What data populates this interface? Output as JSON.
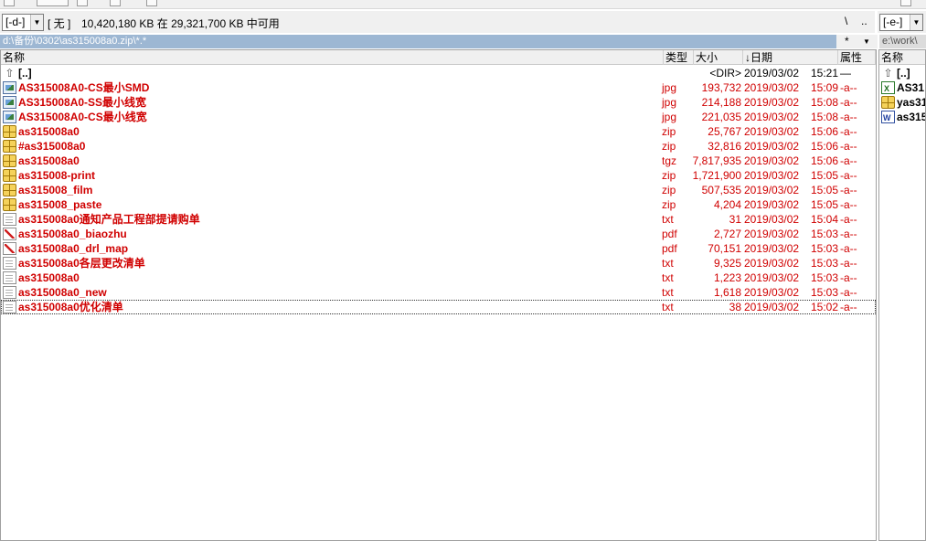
{
  "left_panel": {
    "drive": "[-d-]",
    "volume_label": "[ 无 ]",
    "free_space": "10,420,180 KB 在 29,321,700 KB 中可用",
    "nav_root": "\\",
    "nav_up": "..",
    "path": "d:\\备份\\0302\\as315008a0.zip\\*.*",
    "filter": "*",
    "filter_arrow": "▼",
    "columns": {
      "name": "名称",
      "ext": "类型",
      "size": "大小",
      "date": "↓日期",
      "attr": "属性"
    },
    "rows": [
      {
        "icon": "up-dir-icon",
        "name": "[..]",
        "ext": "",
        "size": "<DIR>",
        "date": "2019/03/02",
        "time": "15:21",
        "attr": "—",
        "red": false
      },
      {
        "icon": "image-icon",
        "name": "AS315008A0-CS最小SMD",
        "ext": "jpg",
        "size": "193,732",
        "date": "2019/03/02",
        "time": "15:09",
        "attr": "-a--",
        "red": true
      },
      {
        "icon": "image-icon",
        "name": "AS315008A0-SS最小线宽",
        "ext": "jpg",
        "size": "214,188",
        "date": "2019/03/02",
        "time": "15:08",
        "attr": "-a--",
        "red": true
      },
      {
        "icon": "image-icon",
        "name": "AS315008A0-CS最小线宽",
        "ext": "jpg",
        "size": "221,035",
        "date": "2019/03/02",
        "time": "15:08",
        "attr": "-a--",
        "red": true
      },
      {
        "icon": "archive-icon",
        "name": "as315008a0",
        "ext": "zip",
        "size": "25,767",
        "date": "2019/03/02",
        "time": "15:06",
        "attr": "-a--",
        "red": true
      },
      {
        "icon": "archive-icon",
        "name": "#as315008a0",
        "ext": "zip",
        "size": "32,816",
        "date": "2019/03/02",
        "time": "15:06",
        "attr": "-a--",
        "red": true
      },
      {
        "icon": "archive-icon",
        "name": "as315008a0",
        "ext": "tgz",
        "size": "7,817,935",
        "date": "2019/03/02",
        "time": "15:06",
        "attr": "-a--",
        "red": true
      },
      {
        "icon": "archive-icon",
        "name": "as315008-print",
        "ext": "zip",
        "size": "1,721,900",
        "date": "2019/03/02",
        "time": "15:05",
        "attr": "-a--",
        "red": true
      },
      {
        "icon": "archive-icon",
        "name": "as315008_film",
        "ext": "zip",
        "size": "507,535",
        "date": "2019/03/02",
        "time": "15:05",
        "attr": "-a--",
        "red": true
      },
      {
        "icon": "archive-icon",
        "name": "as315008_paste",
        "ext": "zip",
        "size": "4,204",
        "date": "2019/03/02",
        "time": "15:05",
        "attr": "-a--",
        "red": true
      },
      {
        "icon": "text-file-icon",
        "name": "as315008a0通知产品工程部提请购单",
        "ext": "txt",
        "size": "31",
        "date": "2019/03/02",
        "time": "15:04",
        "attr": "-a--",
        "red": true
      },
      {
        "icon": "pdf-icon",
        "name": "as315008a0_biaozhu",
        "ext": "pdf",
        "size": "2,727",
        "date": "2019/03/02",
        "time": "15:03",
        "attr": "-a--",
        "red": true
      },
      {
        "icon": "pdf-icon",
        "name": "as315008a0_drl_map",
        "ext": "pdf",
        "size": "70,151",
        "date": "2019/03/02",
        "time": "15:03",
        "attr": "-a--",
        "red": true
      },
      {
        "icon": "text-file-icon",
        "name": "as315008a0各层更改清单",
        "ext": "txt",
        "size": "9,325",
        "date": "2019/03/02",
        "time": "15:03",
        "attr": "-a--",
        "red": true
      },
      {
        "icon": "text-file-icon",
        "name": "as315008a0",
        "ext": "txt",
        "size": "1,223",
        "date": "2019/03/02",
        "time": "15:03",
        "attr": "-a--",
        "red": true
      },
      {
        "icon": "text-file-icon",
        "name": "as315008a0_new",
        "ext": "txt",
        "size": "1,618",
        "date": "2019/03/02",
        "time": "15:03",
        "attr": "-a--",
        "red": true
      },
      {
        "icon": "text-file-icon",
        "name": "as315008a0优化清单",
        "ext": "txt",
        "size": "38",
        "date": "2019/03/02",
        "time": "15:02",
        "attr": "-a--",
        "red": true
      }
    ]
  },
  "right_panel": {
    "drive": "[-e-]",
    "path": "e:\\work\\",
    "columns": {
      "name": "名称"
    },
    "rows": [
      {
        "icon": "up-dir-icon",
        "name": "[..]"
      },
      {
        "icon": "excel-icon",
        "name": "AS31"
      },
      {
        "icon": "archive-icon",
        "name": "yas31"
      },
      {
        "icon": "word-icon",
        "name": "as315"
      }
    ]
  },
  "colors": {
    "red_text": "#d00000",
    "active_path": "#9db7d3"
  }
}
